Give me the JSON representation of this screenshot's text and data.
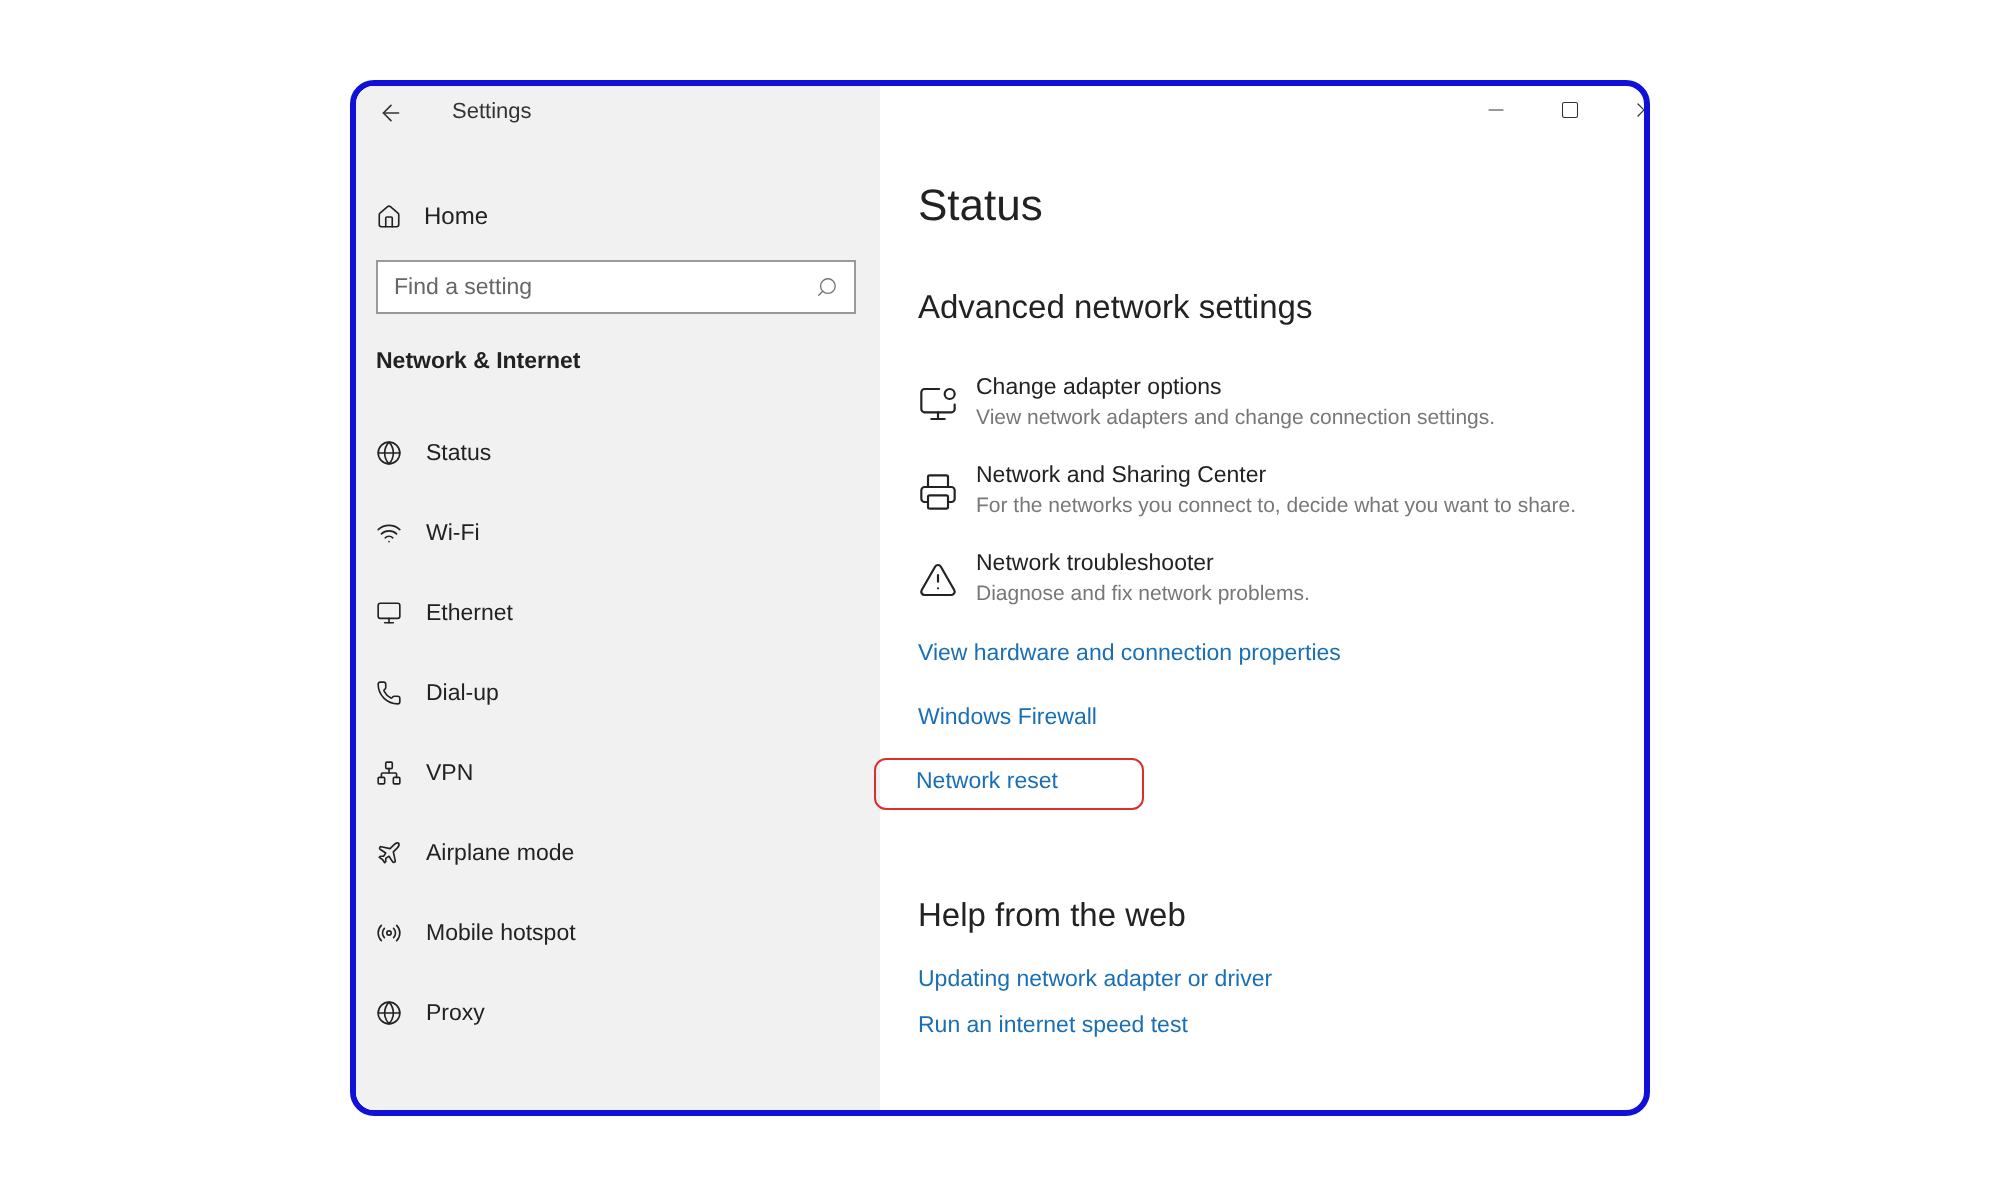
{
  "window": {
    "title": "Settings"
  },
  "sidebar": {
    "home": "Home",
    "search": {
      "placeholder": "Find a setting"
    },
    "section": "Network & Internet",
    "items": [
      {
        "label": "Status"
      },
      {
        "label": "Wi-Fi"
      },
      {
        "label": "Ethernet"
      },
      {
        "label": "Dial-up"
      },
      {
        "label": "VPN"
      },
      {
        "label": "Airplane mode"
      },
      {
        "label": "Mobile hotspot"
      },
      {
        "label": "Proxy"
      }
    ]
  },
  "content": {
    "title": "Status",
    "advanced": {
      "heading": "Advanced network settings",
      "options": [
        {
          "title": "Change adapter options",
          "description": "View network adapters and change connection settings."
        },
        {
          "title": "Network and Sharing Center",
          "description": "For the networks you connect to, decide what you want to share."
        },
        {
          "title": "Network troubleshooter",
          "description": "Diagnose and fix network problems."
        }
      ],
      "links": [
        {
          "label": "View hardware and connection properties",
          "highlighted": false
        },
        {
          "label": "Windows Firewall",
          "highlighted": false
        },
        {
          "label": "Network reset",
          "highlighted": true
        }
      ]
    },
    "help": {
      "heading": "Help from the web",
      "links": [
        "Updating network adapter or driver",
        "Run an internet speed test"
      ]
    }
  }
}
